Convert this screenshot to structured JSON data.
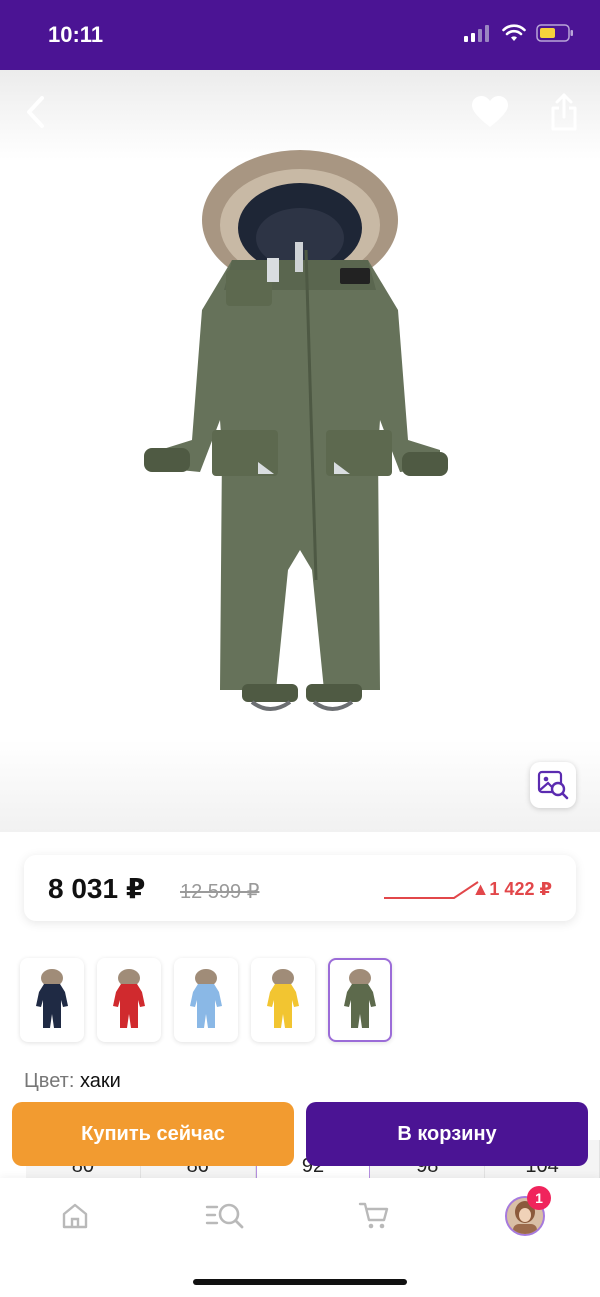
{
  "status_bar": {
    "time": "10:11"
  },
  "header": {
    "back_icon": "chevron-left-icon",
    "favorite_icon": "heart-icon",
    "share_icon": "share-icon"
  },
  "product": {
    "image_alt": "khaki winter jumpsuit with fur hood",
    "visual_search_icon": "image-search-icon"
  },
  "price": {
    "current": "8 031 ₽",
    "old": "12 599 ₽",
    "change": "▲1 422 ₽",
    "accent": "#e2474a"
  },
  "swatches": [
    {
      "color": "#1f2a44"
    },
    {
      "color": "#d02a2e"
    },
    {
      "color": "#8ab8e6"
    },
    {
      "color": "#f2c531"
    },
    {
      "color": "#5d6a4c"
    }
  ],
  "color": {
    "label": "Цвет:",
    "value": "хаки"
  },
  "sizes": [
    "80",
    "86",
    "92",
    "98",
    "104"
  ],
  "actions": {
    "buy_now": "Купить сейчас",
    "add_to_cart": "В корзину",
    "buy_color": "#f29b30",
    "cart_color": "#4b1494"
  },
  "tab_bar": {
    "cart_badge": "1",
    "items": [
      "home-icon",
      "catalog-search-icon",
      "cart-icon",
      "profile-avatar"
    ]
  }
}
